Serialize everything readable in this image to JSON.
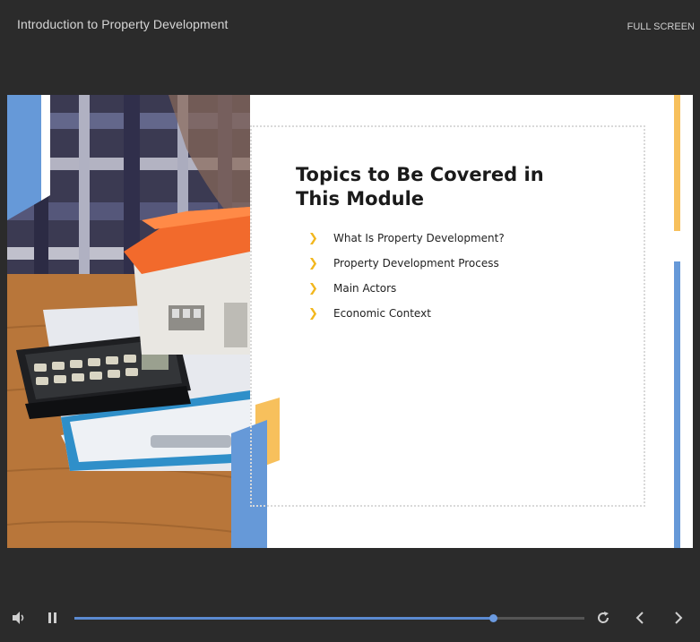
{
  "header": {
    "course_title": "Introduction to Property Development",
    "fullscreen_label": "FULL SCREEN"
  },
  "slide": {
    "title": "Topics to Be Covered in This Module",
    "topics": [
      "What Is Property Development?",
      "Property Development Process",
      "Main Actors",
      "Economic Context"
    ],
    "colors": {
      "accent_blue": "#6699d8",
      "accent_yellow": "#f7c05c",
      "bullet_yellow": "#f2b71e"
    }
  },
  "player": {
    "progress": 0.82,
    "buffered": 0.72,
    "icons": [
      "volume-icon",
      "pause-icon",
      "replay-icon",
      "previous-icon",
      "next-icon"
    ]
  }
}
